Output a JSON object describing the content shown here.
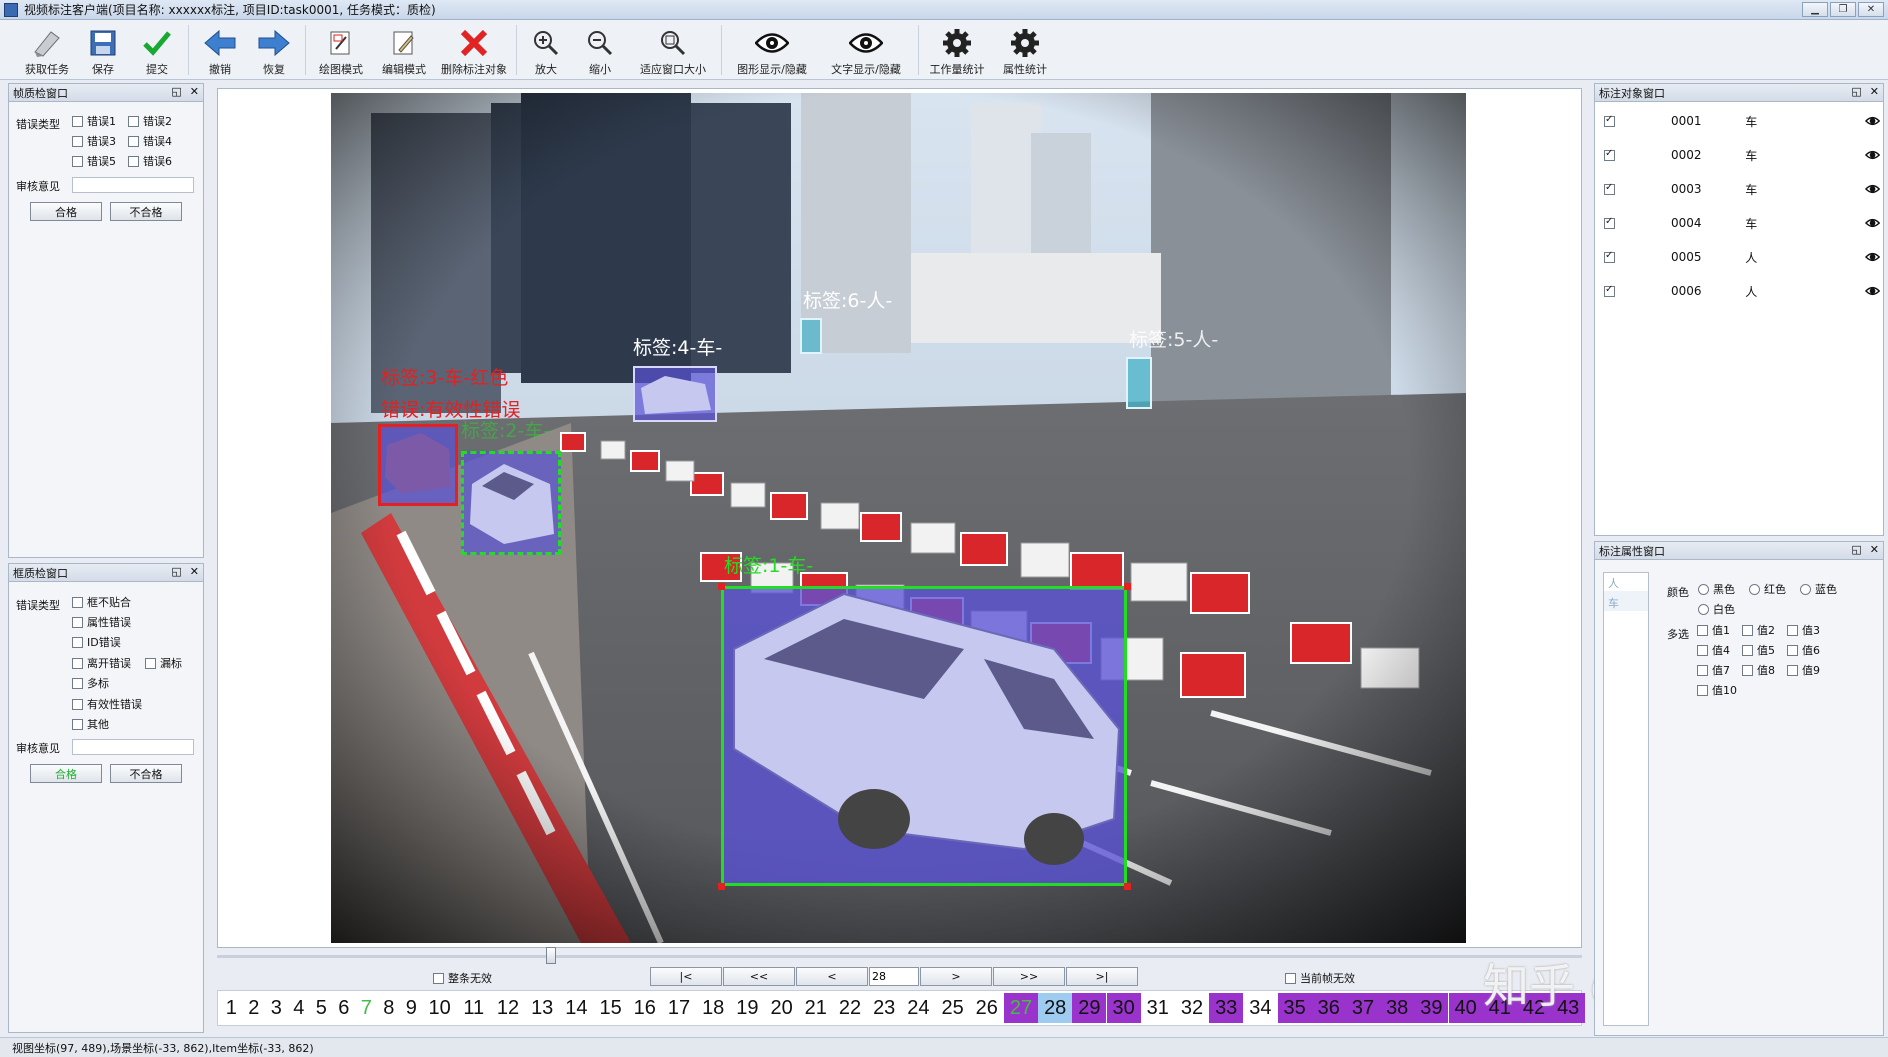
{
  "window": {
    "title": "视频标注客户端(项目名称: xxxxxx标注, 项目ID:task0001, 任务模式：质检)"
  },
  "toolbar": [
    {
      "label": "获取任务",
      "icon": "get-task-icon"
    },
    {
      "label": "保存",
      "icon": "save-icon"
    },
    {
      "label": "提交",
      "icon": "submit-check-icon"
    },
    {
      "label": "撤销",
      "icon": "undo-arrow-icon"
    },
    {
      "label": "恢复",
      "icon": "redo-arrow-icon"
    },
    {
      "label": "绘图模式",
      "icon": "draw-mode-icon"
    },
    {
      "label": "编辑模式",
      "icon": "edit-mode-icon"
    },
    {
      "label": "删除标注对象",
      "icon": "delete-x-icon"
    },
    {
      "label": "放大",
      "icon": "zoom-in-icon"
    },
    {
      "label": "缩小",
      "icon": "zoom-out-icon"
    },
    {
      "label": "适应窗口大小",
      "icon": "fit-window-icon"
    },
    {
      "label": "图形显示/隐藏",
      "icon": "eye-icon"
    },
    {
      "label": "文字显示/隐藏",
      "icon": "eye-icon"
    },
    {
      "label": "工作量统计",
      "icon": "gear-icon"
    },
    {
      "label": "属性统计",
      "icon": "gear-icon"
    }
  ],
  "frame_qc": {
    "title": "帧质检窗口",
    "error_type_label": "错误类型",
    "errors": [
      "错误1",
      "错误2",
      "错误3",
      "错误4",
      "错误5",
      "错误6"
    ],
    "review_label": "审核意见",
    "pass": "合格",
    "fail": "不合格"
  },
  "box_qc": {
    "title": "框质检窗口",
    "error_type_label": "错误类型",
    "errors": [
      "框不贴合",
      "属性错误",
      "ID错误",
      "离开错误",
      "漏标",
      "多标",
      "有效性错误",
      "其他"
    ],
    "review_label": "审核意见",
    "pass": "合格",
    "fail": "不合格"
  },
  "annotations": {
    "label1": "标签:1-车-",
    "label2": "标签:2-车-",
    "label3": "标签:3-车-红色",
    "label3_error": "错误:有效性错误",
    "label4": "标签:4-车-",
    "label5": "标签:5-人-",
    "label6": "标签:6-人-"
  },
  "object_panel": {
    "title": "标注对象窗口",
    "objects": [
      {
        "id": "0001",
        "type": "车"
      },
      {
        "id": "0002",
        "type": "车"
      },
      {
        "id": "0003",
        "type": "车"
      },
      {
        "id": "0004",
        "type": "车"
      },
      {
        "id": "0005",
        "type": "人"
      },
      {
        "id": "0006",
        "type": "人"
      }
    ]
  },
  "attr_panel": {
    "title": "标注属性窗口",
    "list": [
      "人",
      "车"
    ],
    "color_label": "颜色",
    "colors": [
      "黑色",
      "红色",
      "蓝色",
      "白色"
    ],
    "multi_label": "多选",
    "values": [
      "值1",
      "值2",
      "值3",
      "值4",
      "值5",
      "值6",
      "值7",
      "值8",
      "值9",
      "值10"
    ]
  },
  "nav": {
    "whole_invalid": "整条无效",
    "current_invalid": "当前帧无效",
    "first": "|<",
    "prev_fast": "<<",
    "prev": "<",
    "frame_value": "28",
    "next": ">",
    "next_fast": ">>",
    "last": ">|"
  },
  "frames": [
    "1",
    "2",
    "3",
    "4",
    "5",
    "6",
    "7",
    "8",
    "9",
    "10",
    "11",
    "12",
    "13",
    "14",
    "15",
    "16",
    "17",
    "18",
    "19",
    "20",
    "21",
    "22",
    "23",
    "24",
    "25",
    "26",
    "27",
    "28",
    "29",
    "30",
    "31",
    "32",
    "33",
    "34",
    "35",
    "36",
    "37",
    "38",
    "39",
    "40",
    "41",
    "42",
    "43"
  ],
  "watermark": "知乎 @西陵侠",
  "status": "视图坐标(97, 489),场景坐标(-33, 862),Item坐标(-33, 862)",
  "colors": {
    "box_fill": "#5a52d6",
    "box_green": "#22dd22",
    "box_red": "#e52020",
    "frame_purple": "#9933cc",
    "frame_green": "#44bb44",
    "frame_current": "#9ecbf0"
  }
}
